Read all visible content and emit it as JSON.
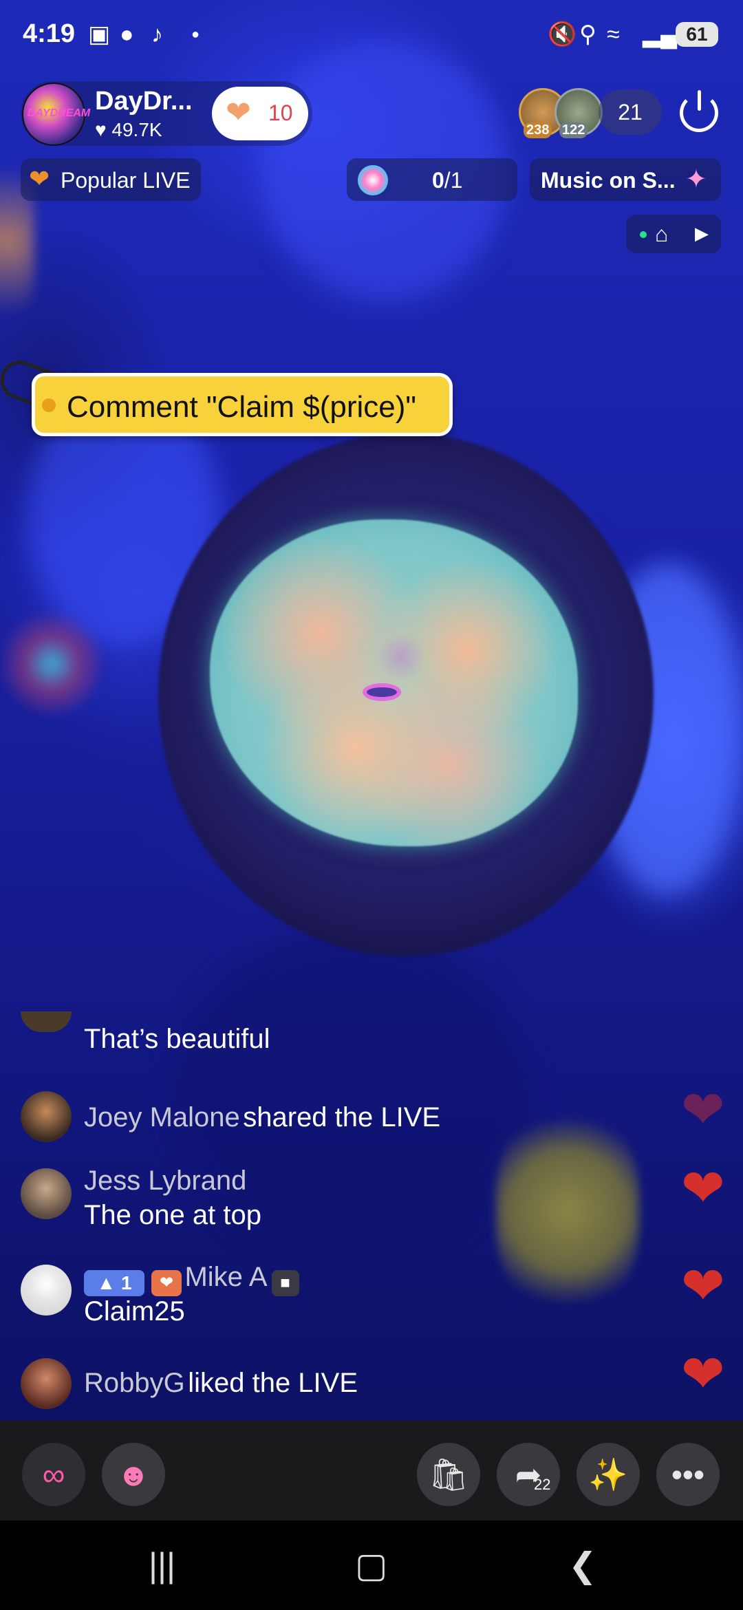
{
  "status_bar": {
    "time": "4:19",
    "battery": "61",
    "icons": [
      "screenshot-icon",
      "messenger-icon",
      "tiktok-icon",
      "dot-icon",
      "mute-icon",
      "location-icon",
      "wifi-icon",
      "signal-icon"
    ]
  },
  "host": {
    "name": "DayDr...",
    "likes": "49.7K",
    "avatar_text": "DAYDREAM",
    "follow_count": "10"
  },
  "viewers": {
    "top1_score": "238",
    "top2_score": "122",
    "count": "21"
  },
  "badges": {
    "popular_live": "Popular LIVE",
    "goal_current": "0",
    "goal_total": "/1",
    "music": "Music on S..."
  },
  "claim_tag": {
    "text": "Comment \"Claim $(price)\""
  },
  "comments": [
    {
      "name": "",
      "text": "That’s beautiful"
    },
    {
      "name": "Joey Malone",
      "text": "shared the LIVE"
    },
    {
      "name": "Jess Lybrand",
      "text": "The one at top"
    },
    {
      "name": "Mike A",
      "level": "1",
      "text": "Claim25"
    },
    {
      "name": "RobbyG",
      "text": "liked the LIVE"
    }
  ],
  "toolbar": {
    "share_count": "22",
    "buttons": [
      "collab-icon",
      "guests-icon",
      "shopping-bag-icon",
      "share-icon",
      "magic-wand-icon",
      "more-icon"
    ]
  },
  "colors": {
    "video_bg": "#1a22a8",
    "claim_tag": "#f7d23b",
    "heart": "#d6302c",
    "follow_heart": "#f4a06a",
    "level_badge": "#5a7de8"
  }
}
